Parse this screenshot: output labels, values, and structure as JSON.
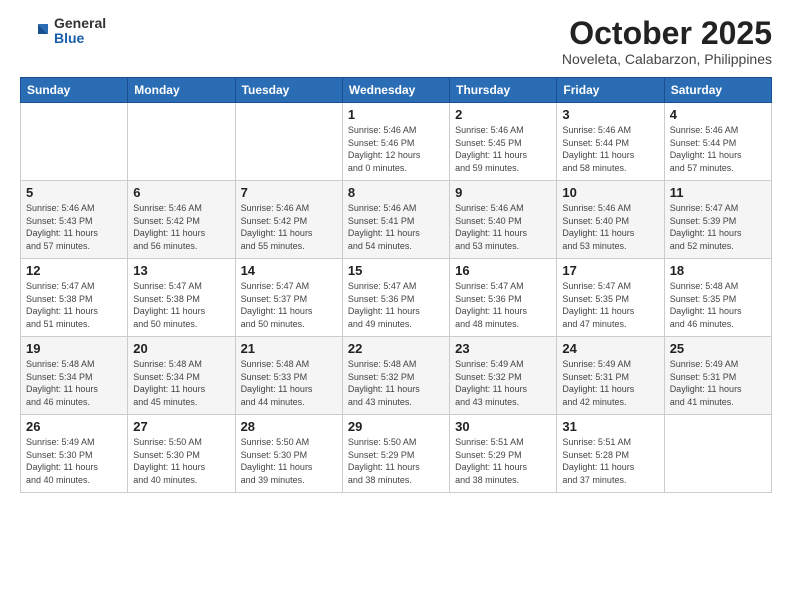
{
  "header": {
    "logo": {
      "general": "General",
      "blue": "Blue"
    },
    "title": "October 2025",
    "subtitle": "Noveleta, Calabarzon, Philippines"
  },
  "days_of_week": [
    "Sunday",
    "Monday",
    "Tuesday",
    "Wednesday",
    "Thursday",
    "Friday",
    "Saturday"
  ],
  "weeks": [
    [
      {
        "day": "",
        "info": ""
      },
      {
        "day": "",
        "info": ""
      },
      {
        "day": "",
        "info": ""
      },
      {
        "day": "1",
        "info": "Sunrise: 5:46 AM\nSunset: 5:46 PM\nDaylight: 12 hours\nand 0 minutes."
      },
      {
        "day": "2",
        "info": "Sunrise: 5:46 AM\nSunset: 5:45 PM\nDaylight: 11 hours\nand 59 minutes."
      },
      {
        "day": "3",
        "info": "Sunrise: 5:46 AM\nSunset: 5:44 PM\nDaylight: 11 hours\nand 58 minutes."
      },
      {
        "day": "4",
        "info": "Sunrise: 5:46 AM\nSunset: 5:44 PM\nDaylight: 11 hours\nand 57 minutes."
      }
    ],
    [
      {
        "day": "5",
        "info": "Sunrise: 5:46 AM\nSunset: 5:43 PM\nDaylight: 11 hours\nand 57 minutes."
      },
      {
        "day": "6",
        "info": "Sunrise: 5:46 AM\nSunset: 5:42 PM\nDaylight: 11 hours\nand 56 minutes."
      },
      {
        "day": "7",
        "info": "Sunrise: 5:46 AM\nSunset: 5:42 PM\nDaylight: 11 hours\nand 55 minutes."
      },
      {
        "day": "8",
        "info": "Sunrise: 5:46 AM\nSunset: 5:41 PM\nDaylight: 11 hours\nand 54 minutes."
      },
      {
        "day": "9",
        "info": "Sunrise: 5:46 AM\nSunset: 5:40 PM\nDaylight: 11 hours\nand 53 minutes."
      },
      {
        "day": "10",
        "info": "Sunrise: 5:46 AM\nSunset: 5:40 PM\nDaylight: 11 hours\nand 53 minutes."
      },
      {
        "day": "11",
        "info": "Sunrise: 5:47 AM\nSunset: 5:39 PM\nDaylight: 11 hours\nand 52 minutes."
      }
    ],
    [
      {
        "day": "12",
        "info": "Sunrise: 5:47 AM\nSunset: 5:38 PM\nDaylight: 11 hours\nand 51 minutes."
      },
      {
        "day": "13",
        "info": "Sunrise: 5:47 AM\nSunset: 5:38 PM\nDaylight: 11 hours\nand 50 minutes."
      },
      {
        "day": "14",
        "info": "Sunrise: 5:47 AM\nSunset: 5:37 PM\nDaylight: 11 hours\nand 50 minutes."
      },
      {
        "day": "15",
        "info": "Sunrise: 5:47 AM\nSunset: 5:36 PM\nDaylight: 11 hours\nand 49 minutes."
      },
      {
        "day": "16",
        "info": "Sunrise: 5:47 AM\nSunset: 5:36 PM\nDaylight: 11 hours\nand 48 minutes."
      },
      {
        "day": "17",
        "info": "Sunrise: 5:47 AM\nSunset: 5:35 PM\nDaylight: 11 hours\nand 47 minutes."
      },
      {
        "day": "18",
        "info": "Sunrise: 5:48 AM\nSunset: 5:35 PM\nDaylight: 11 hours\nand 46 minutes."
      }
    ],
    [
      {
        "day": "19",
        "info": "Sunrise: 5:48 AM\nSunset: 5:34 PM\nDaylight: 11 hours\nand 46 minutes."
      },
      {
        "day": "20",
        "info": "Sunrise: 5:48 AM\nSunset: 5:34 PM\nDaylight: 11 hours\nand 45 minutes."
      },
      {
        "day": "21",
        "info": "Sunrise: 5:48 AM\nSunset: 5:33 PM\nDaylight: 11 hours\nand 44 minutes."
      },
      {
        "day": "22",
        "info": "Sunrise: 5:48 AM\nSunset: 5:32 PM\nDaylight: 11 hours\nand 43 minutes."
      },
      {
        "day": "23",
        "info": "Sunrise: 5:49 AM\nSunset: 5:32 PM\nDaylight: 11 hours\nand 43 minutes."
      },
      {
        "day": "24",
        "info": "Sunrise: 5:49 AM\nSunset: 5:31 PM\nDaylight: 11 hours\nand 42 minutes."
      },
      {
        "day": "25",
        "info": "Sunrise: 5:49 AM\nSunset: 5:31 PM\nDaylight: 11 hours\nand 41 minutes."
      }
    ],
    [
      {
        "day": "26",
        "info": "Sunrise: 5:49 AM\nSunset: 5:30 PM\nDaylight: 11 hours\nand 40 minutes."
      },
      {
        "day": "27",
        "info": "Sunrise: 5:50 AM\nSunset: 5:30 PM\nDaylight: 11 hours\nand 40 minutes."
      },
      {
        "day": "28",
        "info": "Sunrise: 5:50 AM\nSunset: 5:30 PM\nDaylight: 11 hours\nand 39 minutes."
      },
      {
        "day": "29",
        "info": "Sunrise: 5:50 AM\nSunset: 5:29 PM\nDaylight: 11 hours\nand 38 minutes."
      },
      {
        "day": "30",
        "info": "Sunrise: 5:51 AM\nSunset: 5:29 PM\nDaylight: 11 hours\nand 38 minutes."
      },
      {
        "day": "31",
        "info": "Sunrise: 5:51 AM\nSunset: 5:28 PM\nDaylight: 11 hours\nand 37 minutes."
      },
      {
        "day": "",
        "info": ""
      }
    ]
  ]
}
